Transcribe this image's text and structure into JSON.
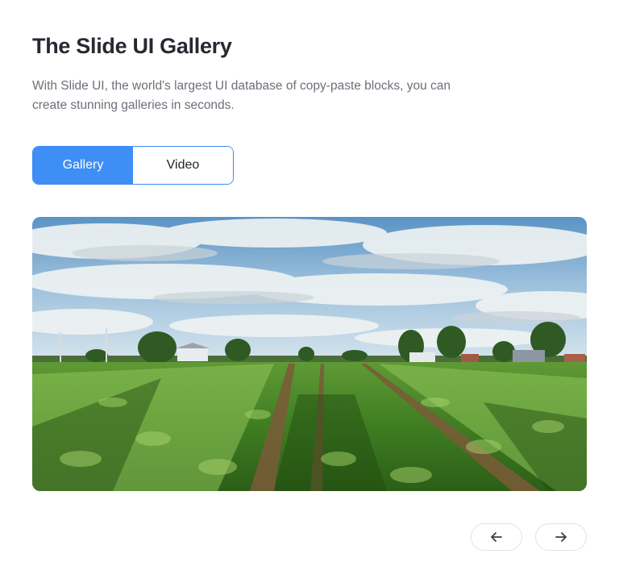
{
  "header": {
    "title": "The Slide UI Gallery",
    "description": "With Slide UI, the world's largest UI database of copy-paste blocks, you can create stunning galleries in seconds."
  },
  "tabs": [
    {
      "label": "Gallery",
      "active": true
    },
    {
      "label": "Video",
      "active": false
    }
  ],
  "gallery": {
    "current_image": "farm-field-landscape"
  },
  "navigation": {
    "prev_icon": "arrow-left-icon",
    "next_icon": "arrow-right-icon"
  },
  "colors": {
    "accent": "#3e8ef6",
    "title": "#262a30",
    "body_text": "#6b7079",
    "nav_border": "#dfe2e6"
  }
}
